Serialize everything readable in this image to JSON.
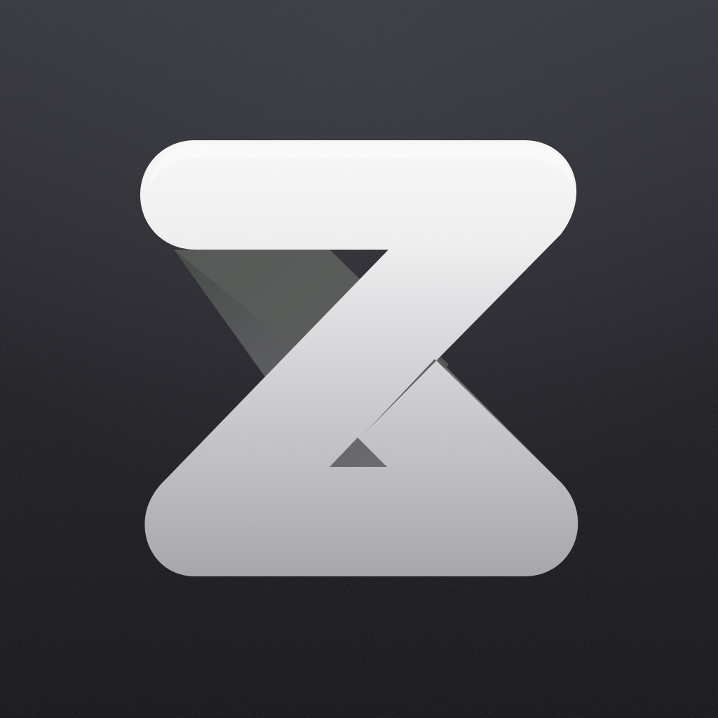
{
  "icon": {
    "name": "z-logo-icon",
    "style": "monochrome-ribbon",
    "colors": {
      "background_top": "#2e2e36",
      "background_bottom": "#0f0f14",
      "ribbon_light": "#fafafa",
      "ribbon_mid": "#d2d2d6",
      "ribbon_dark": "#a6a6ab",
      "ribbon_back": "#6e6e72"
    }
  }
}
